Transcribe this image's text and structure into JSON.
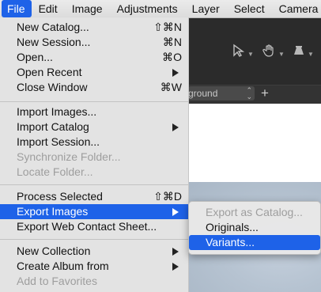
{
  "menubar": {
    "items": [
      "File",
      "Edit",
      "Image",
      "Adjustments",
      "Layer",
      "Select",
      "Camera"
    ]
  },
  "background": {
    "select_value": "ground"
  },
  "file_menu": {
    "groups": [
      [
        {
          "label": "New Catalog...",
          "shortcut": "⇧⌘N"
        },
        {
          "label": "New Session...",
          "shortcut": "⌘N"
        },
        {
          "label": "Open...",
          "shortcut": "⌘O"
        },
        {
          "label": "Open Recent",
          "submenu": true
        },
        {
          "label": "Close Window",
          "shortcut": "⌘W"
        }
      ],
      [
        {
          "label": "Import Images..."
        },
        {
          "label": "Import Catalog",
          "submenu": true
        },
        {
          "label": "Import Session..."
        },
        {
          "label": "Synchronize Folder...",
          "disabled": true
        },
        {
          "label": "Locate Folder...",
          "disabled": true
        }
      ],
      [
        {
          "label": "Process Selected",
          "shortcut": "⇧⌘D"
        },
        {
          "label": "Export Images",
          "submenu": true,
          "highlighted": true
        },
        {
          "label": "Export Web Contact Sheet..."
        }
      ],
      [
        {
          "label": "New Collection",
          "submenu": true
        },
        {
          "label": "Create Album from",
          "submenu": true
        },
        {
          "label": "Add to Favorites",
          "disabled": true
        }
      ]
    ]
  },
  "export_submenu": {
    "items": [
      {
        "label": "Export as Catalog...",
        "disabled": true
      },
      {
        "label": "Originals..."
      },
      {
        "label": "Variants...",
        "highlighted": true
      }
    ]
  },
  "colors": {
    "highlight": "#1e62e8",
    "disabled_text": "#9e9e9e"
  }
}
